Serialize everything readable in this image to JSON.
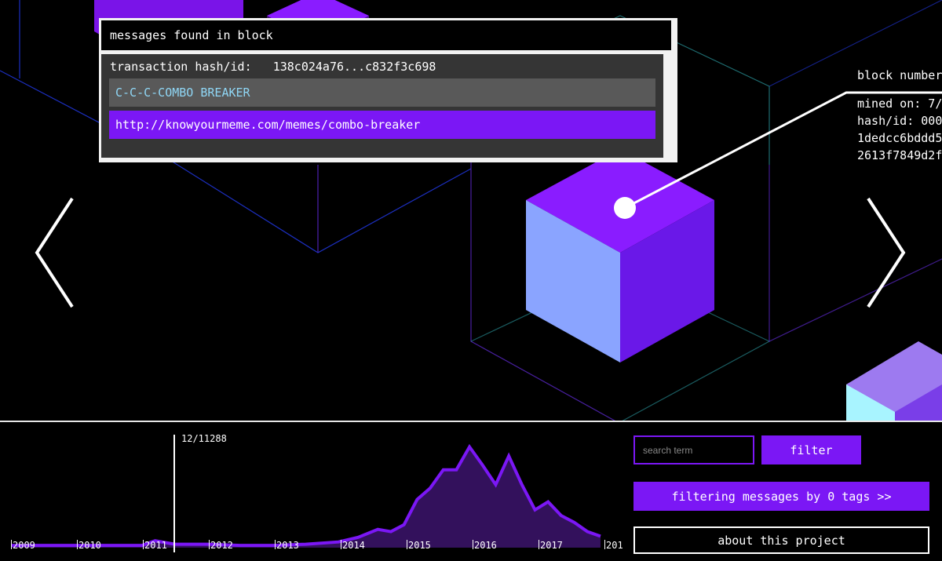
{
  "messages_panel": {
    "title": "messages found in block",
    "tx_label": "transaction hash/id:",
    "tx_value": "138c024a76...c832f3c698",
    "messages": [
      "C-C-C-COMBO BREAKER",
      "http://knowyourmeme.com/memes/combo-breaker"
    ]
  },
  "block_info": {
    "title": "block number",
    "mined_on": "mined on: 7/",
    "hash_line1": "hash/id: 000",
    "hash_line2": "1dedcc6bddd5",
    "hash_line3": "2613f7849d2f"
  },
  "navigation": {
    "prev_icon": "chevron-left-icon",
    "next_icon": "chevron-right-icon"
  },
  "timeline": {
    "cursor_label": "12/11288",
    "years": [
      "2009",
      "2010",
      "2011",
      "2012",
      "2013",
      "2014",
      "2015",
      "2016",
      "2017",
      "201"
    ]
  },
  "chart_data": {
    "type": "area",
    "x": [
      "2009",
      "2009.5",
      "2010",
      "2010.5",
      "2011",
      "2011.2",
      "2011.5",
      "2012",
      "2012.5",
      "2013",
      "2013.5",
      "2014",
      "2014.3",
      "2014.6",
      "2014.8",
      "2015",
      "2015.2",
      "2015.4",
      "2015.6",
      "2015.8",
      "2016",
      "2016.2",
      "2016.4",
      "2016.6",
      "2016.8",
      "2017",
      "2017.2",
      "2017.4",
      "2017.6",
      "2017.8",
      "2018"
    ],
    "values": [
      2,
      2,
      2,
      2,
      2,
      6,
      3,
      3,
      2,
      2,
      3,
      5,
      9,
      16,
      14,
      20,
      42,
      52,
      68,
      68,
      88,
      72,
      55,
      80,
      55,
      33,
      40,
      28,
      22,
      14,
      10
    ],
    "ylim": [
      0,
      100
    ],
    "colors": {
      "line": "#7b17f5",
      "fill": "#33115c"
    }
  },
  "controls": {
    "search_placeholder": "search term",
    "filter_label": "filter",
    "tags_label": "filtering messages by 0 tags >>",
    "about_label": "about this project"
  },
  "colors": {
    "accent": "#7b17f5",
    "highlight_text": "#8fd6f5"
  }
}
